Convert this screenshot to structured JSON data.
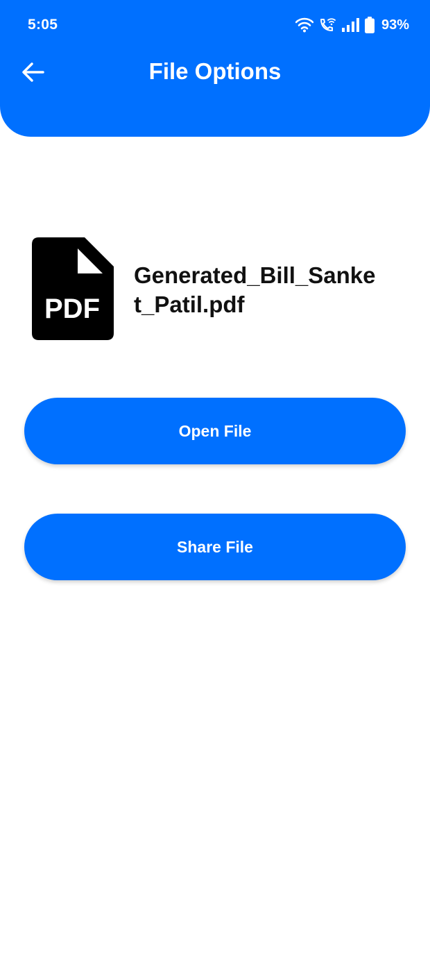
{
  "status_bar": {
    "time": "5:05",
    "battery_percent": "93%",
    "icons": [
      "wifi-icon",
      "wifi-calling-icon",
      "signal-icon",
      "battery-icon"
    ]
  },
  "header": {
    "title": "File Options",
    "back_icon": "arrow-left-icon"
  },
  "file": {
    "icon": "pdf-file-icon",
    "icon_label": "PDF",
    "name": "Generated_Bill_Sanket_Patil.pdf"
  },
  "actions": {
    "open_label": "Open File",
    "share_label": "Share File"
  },
  "colors": {
    "primary": "#0070FF",
    "background": "#FFFFFF",
    "text": "#111111"
  }
}
